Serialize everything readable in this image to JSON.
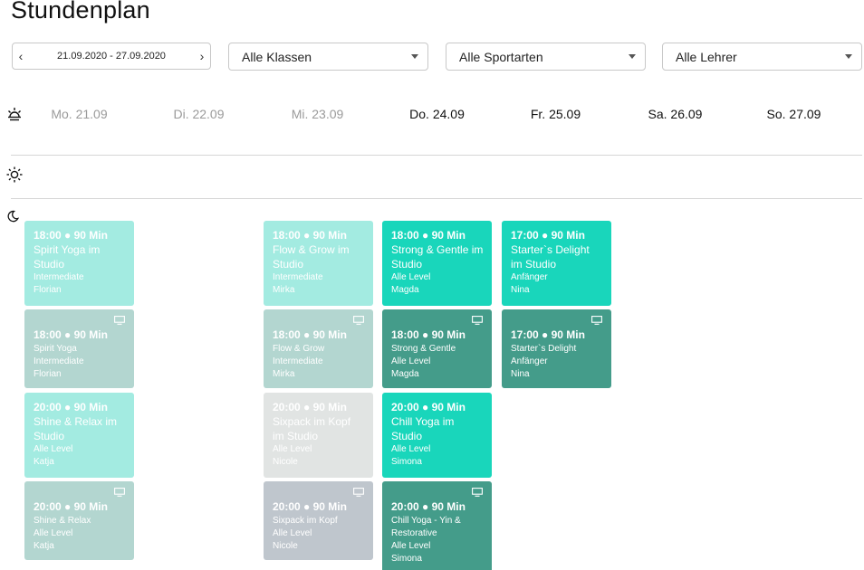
{
  "page": {
    "title": "Stundenplan"
  },
  "filters": {
    "week_range": "21.09.2020 - 27.09.2020",
    "prev_arrow": "‹",
    "next_arrow": "›",
    "klassen": "Alle Klassen",
    "sportarten": "Alle Sportarten",
    "lehrer": "Alle Lehrer"
  },
  "icons": {
    "morning": "sunrise-icon",
    "midday": "sun-icon",
    "evening": "moon-icon",
    "online": "monitor-icon"
  },
  "colors": {
    "studio": "#19d6bb",
    "online": "#449c8a",
    "past_studio": "#a3ebe1",
    "past_online": "#b3d6d0",
    "past_cancelled": "#e1e4e3",
    "past_cancelled_online": "#bfc6cd"
  },
  "days": [
    {
      "label": "Mo. 21.09",
      "past": true
    },
    {
      "label": "Di. 22.09",
      "past": true
    },
    {
      "label": "Mi. 23.09",
      "past": true
    },
    {
      "label": "Do. 24.09",
      "past": false
    },
    {
      "label": "Fr. 25.09",
      "past": false
    },
    {
      "label": "Sa. 26.09",
      "past": false
    },
    {
      "label": "So. 27.09",
      "past": false
    }
  ],
  "classes": {
    "mon": [
      {
        "time": "18:00 ● 90 Min",
        "title": "Spirit Yoga im Studio",
        "level": "Intermediate",
        "teacher": "Florian"
      },
      {
        "time": "18:00 ● 90 Min",
        "title": "Spirit Yoga",
        "level": "Intermediate",
        "teacher": "Florian"
      },
      {
        "time": "20:00 ● 90 Min",
        "title": "Shine & Relax im Studio",
        "level": "Alle Level",
        "teacher": "Katja"
      },
      {
        "time": "20:00 ● 90 Min",
        "title": "Shine & Relax",
        "level": "Alle Level",
        "teacher": "Katja"
      }
    ],
    "wed": [
      {
        "time": "18:00 ● 90 Min",
        "title": "Flow & Grow im Studio",
        "level": "Intermediate",
        "teacher": "Mirka"
      },
      {
        "time": "18:00 ● 90 Min",
        "title": "Flow & Grow",
        "level": "Intermediate",
        "teacher": "Mirka"
      },
      {
        "time": "20:00 ● 90 Min",
        "title": "Sixpack im Kopf im Studio",
        "level": "Alle Level",
        "teacher": "Nicole"
      },
      {
        "time": "20:00 ● 90 Min",
        "title": "Sixpack im Kopf",
        "level": "Alle Level",
        "teacher": "Nicole"
      }
    ],
    "thu": [
      {
        "time": "18:00 ● 90 Min",
        "title": "Strong & Gentle im Studio",
        "level": "Alle Level",
        "teacher": "Magda"
      },
      {
        "time": "18:00 ● 90 Min",
        "title": "Strong & Gentle",
        "level": "Alle Level",
        "teacher": "Magda"
      },
      {
        "time": "20:00 ● 90 Min",
        "title": "Chill Yoga im Studio",
        "level": "Alle Level",
        "teacher": "Simona"
      },
      {
        "time": "20:00 ● 90 Min",
        "title": "Chill Yoga - Yin & Restorative",
        "level": "Alle Level",
        "teacher": "Simona"
      }
    ],
    "fri": [
      {
        "time": "17:00 ● 90 Min",
        "title": "Starter`s Delight im Studio",
        "level": "Anfänger",
        "teacher": "Nina"
      },
      {
        "time": "17:00 ● 90 Min",
        "title": "Starter`s Delight",
        "level": "Anfänger",
        "teacher": "Nina"
      }
    ]
  }
}
